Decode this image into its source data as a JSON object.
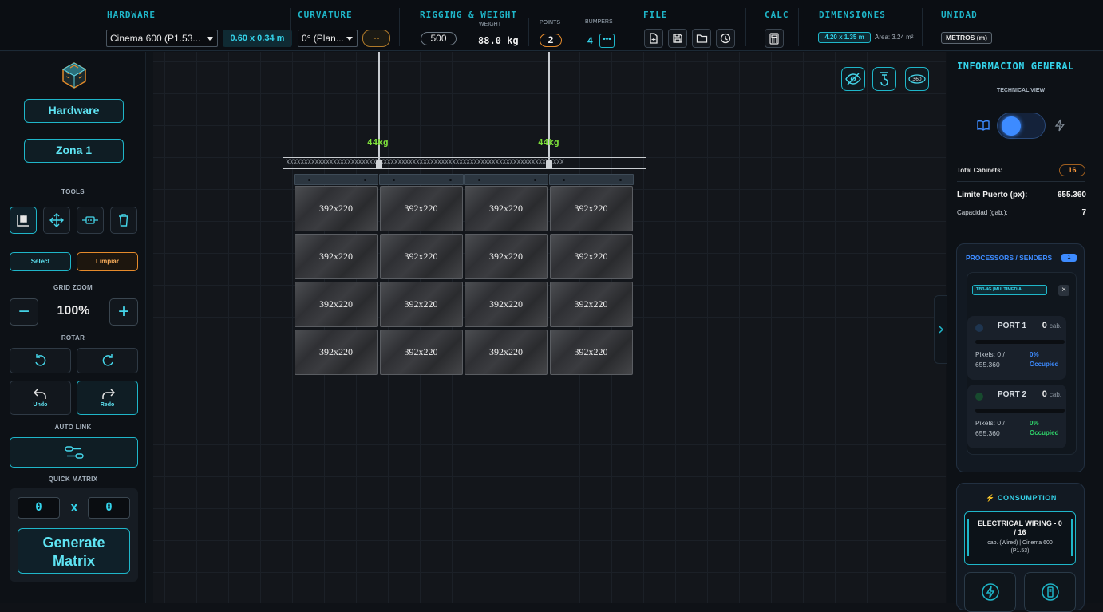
{
  "topbar": {
    "hardware": {
      "title": "HARDWARE",
      "model": "Cinema 600 (P1.53...",
      "size": "0.60 x 0.34 m"
    },
    "curvature": {
      "title": "CURVATURE",
      "value": "0° (Plan...",
      "extra": "--"
    },
    "rigging": {
      "title": "RIGGING & WEIGHT",
      "value": "500",
      "weight_label": "WEIGHT",
      "weight": "88.0 kg",
      "points_label": "POINTS",
      "points": "2",
      "bumpers_label": "BUMPERS",
      "bumpers": "4"
    },
    "file": {
      "title": "FILE"
    },
    "calc": {
      "title": "CALC"
    },
    "dimensions": {
      "title": "DIMENSIONES",
      "value": "4.20 x 1.35 m",
      "area": "Area: 3.24 m²"
    },
    "unit": {
      "title": "UNIDAD",
      "value": "METROS (m)"
    }
  },
  "sidebar": {
    "hardware_btn": "Hardware",
    "zone_btn": "Zona 1",
    "tools_label": "TOOLS",
    "select_btn": "Select",
    "clear_btn": "Limpiar",
    "grid_zoom_label": "GRID ZOOM",
    "zoom_value": "100%",
    "zoom_minus": "−",
    "zoom_plus": "+",
    "rotate_label": "ROTAR",
    "undo": "Undo",
    "redo": "Redo",
    "autolink_label": "AUTO LINK",
    "quick_matrix_label": "QUICK MATRIX",
    "matrix_cols": "0",
    "matrix_x": "x",
    "matrix_rows": "0",
    "generate_line1": "Generate",
    "generate_line2": "Matrix"
  },
  "canvas": {
    "hoist_left_weight": "44kg",
    "hoist_right_weight": "44kg",
    "truss_pattern": "XXXXXXXXXXXXXXXXXXXXXXXXXXXXXXXXXXXXXXXXXXXXXXXXXXXXXXXXXXXXXXXXXXXXXXXXXXXXX",
    "cabinet_label": "392x220",
    "grid_rows": 4,
    "grid_cols": 4,
    "view360_label": "360"
  },
  "right": {
    "title": "INFORMACION GENERAL",
    "technical_view_label": "TECHNICAL VIEW",
    "total_cabinets_label": "Total Cabinets:",
    "total_cabinets": "16",
    "port_limit_label": "Limite Puerto (px):",
    "port_limit": "655.360",
    "capacity_label": "Capacidad (gab.):",
    "capacity": "7",
    "processors_label": "PROCESSORS / SENDERS",
    "processors_count": "1",
    "processor_name": "TB3-4G [MULTIMEDIA ...",
    "processor_close": "×",
    "ports": [
      {
        "name": "PORT 1",
        "count": "0",
        "unit": "cab.",
        "pixels_label": "Pixels: 0 /",
        "pixels_max": "655.360",
        "pct": "0%",
        "occupied": "Occupied",
        "dot": "#1e3550",
        "pct_color": "#3d8bff"
      },
      {
        "name": "PORT 2",
        "count": "0",
        "unit": "cab.",
        "pixels_label": "Pixels: 0 /",
        "pixels_max": "655.360",
        "pct": "0%",
        "occupied": "Occupied",
        "dot": "#174a2e",
        "pct_color": "#2fd36a"
      }
    ],
    "consumption_label": "CONSUMPTION",
    "wiring_title_1": "ELECTRICAL WIRING - 0",
    "wiring_title_2": "/ 16",
    "wiring_sub_1": "cab. (Wired) | Cinema 600",
    "wiring_sub_2": "(P1.53)"
  },
  "colors": {
    "accent": "#1fb6c9",
    "orange": "#e58a2b",
    "green_weight": "#7ee03a"
  }
}
